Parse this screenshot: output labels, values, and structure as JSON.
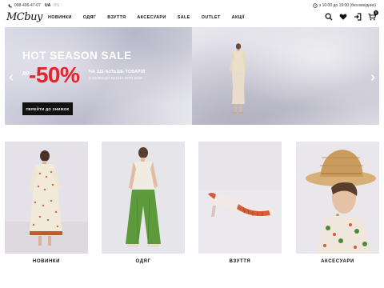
{
  "topbar": {
    "phone": "098-406-47-07",
    "lang_active": "UA",
    "lang_inactive": "RU",
    "hours": "з 10:00 до 19:00 (без вихідних)"
  },
  "header": {
    "logo": "MCbuy",
    "nav": [
      "НОВИНКИ",
      "ОДЯГ",
      "ВЗУТТЯ",
      "АКСЕСУАРИ",
      "SALE",
      "OUTLET",
      "АКЦІЇ"
    ],
    "cart_count": "0"
  },
  "hero": {
    "title": "HOT SEASON SALE",
    "prefix": "до",
    "percent": "-50%",
    "line1": "НА ЩЕ БІЛЬШЕ ТОВАРІВ",
    "line2": "З КОЛЕКЦІЙ ВЕСНА-ЛІТО 2025",
    "cta": "ПЕРЕЙТИ ДО ЗНИЖОК",
    "accent_color": "#e3242b"
  },
  "categories": [
    {
      "label": "НОВИНКИ"
    },
    {
      "label": "ОДЯГ"
    },
    {
      "label": "ВЗУТТЯ"
    },
    {
      "label": "АКСЕСУАРИ"
    }
  ]
}
